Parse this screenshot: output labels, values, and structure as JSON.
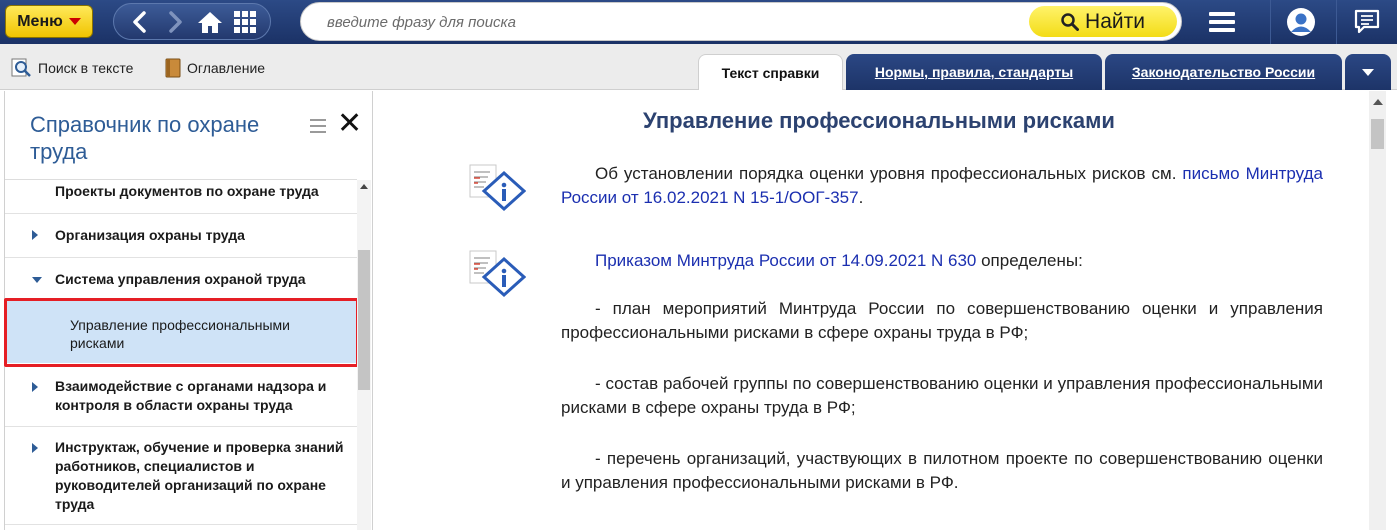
{
  "topbar": {
    "menu_label": "Меню",
    "search_placeholder": "введите фразу для поиска",
    "find_label": "Найти"
  },
  "toolbar": {
    "search_in_text": "Поиск в тексте",
    "contents": "Оглавление",
    "tabs": [
      {
        "label": "Текст справки",
        "active": true
      },
      {
        "label": "Нормы, правила, стандарты",
        "active": false
      },
      {
        "label": "Законодательство России",
        "active": false
      }
    ]
  },
  "sidebar": {
    "title": "Справочник по охране труда",
    "items": [
      {
        "label": "Проекты документов по охране труда",
        "arrow": "none"
      },
      {
        "label": "Организация охраны труда",
        "arrow": "right"
      },
      {
        "label": "Система управления охраной труда",
        "arrow": "down"
      },
      {
        "label": "Управление профессиональными рисками",
        "arrow": "none",
        "selected": true
      },
      {
        "label": "Взаимодействие с органами надзора и контроля в области охраны труда",
        "arrow": "right"
      },
      {
        "label": "Инструктаж, обучение и проверка знаний работников, специалистов и руководителей организаций по охране труда",
        "arrow": "right"
      }
    ]
  },
  "document": {
    "title": "Управление профессиональными рисками",
    "p1_text": "Об установлении порядка оценки уровня профессиональных рисков см. ",
    "p1_link": "письмо Минтруда России от 16.02.2021 N 15-1/ООГ-357",
    "p1_end": ".",
    "p2_link": "Приказом Минтруда России от 14.09.2021 N 630",
    "p2_text": " определены:",
    "p3": "- план мероприятий Минтруда России по совершенствованию оценки и управления профессиональными рисками в сфере охраны труда в РФ;",
    "p4": "- состав рабочей группы по совершенствованию оценки и управления профессиональными рисками в сфере охраны труда в РФ;",
    "p5": "- перечень организаций, участвующих в пилотном проекте по совершенствованию оценки и управления профессиональными рисками в РФ."
  },
  "colors": {
    "accent": "#2e5c96",
    "link": "#1b2fb0",
    "highlight": "#e51e25",
    "selected_bg": "#cfe3f7",
    "menu_yellow": "#f0c400"
  }
}
